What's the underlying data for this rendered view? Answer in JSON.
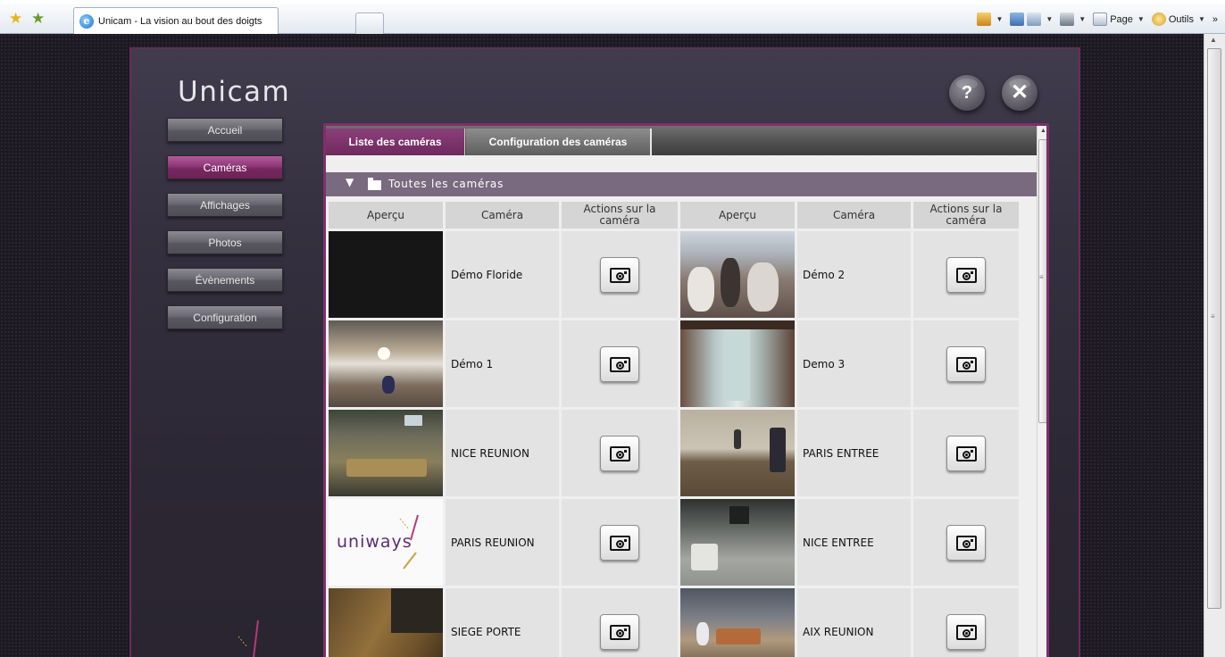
{
  "browser": {
    "tab_title": "Unicam - La vision au bout des doigts",
    "commands": {
      "page": "Page",
      "tools": "Outils"
    }
  },
  "app": {
    "title": "Unicam",
    "help_label": "?",
    "close_label": "✕",
    "accent_color": "#7e2f6b"
  },
  "nav": {
    "items": [
      {
        "label": "Accueil"
      },
      {
        "label": "Caméras"
      },
      {
        "label": "Affichages"
      },
      {
        "label": "Photos"
      },
      {
        "label": "Évènements"
      },
      {
        "label": "Configuration"
      }
    ]
  },
  "tabs": [
    {
      "label": "Liste des caméras"
    },
    {
      "label": "Configuration des caméras"
    }
  ],
  "folder": {
    "label": "Toutes les caméras"
  },
  "table": {
    "headers": [
      "Aperçu",
      "Caméra",
      "Actions sur la caméra",
      "Aperçu",
      "Caméra",
      "Actions sur la caméra"
    ],
    "rows": [
      [
        {
          "name": "Démo Floride"
        },
        {
          "name": "Démo 2"
        }
      ],
      [
        {
          "name": "Démo 1"
        },
        {
          "name": "Demo 3"
        }
      ],
      [
        {
          "name": "NICE REUNION"
        },
        {
          "name": "PARIS ENTREE"
        }
      ],
      [
        {
          "name": "PARIS REUNION",
          "logo_text": "uniways"
        },
        {
          "name": "NICE ENTREE"
        }
      ],
      [
        {
          "name": "SIEGE PORTE"
        },
        {
          "name": "AIX REUNION"
        }
      ]
    ]
  }
}
